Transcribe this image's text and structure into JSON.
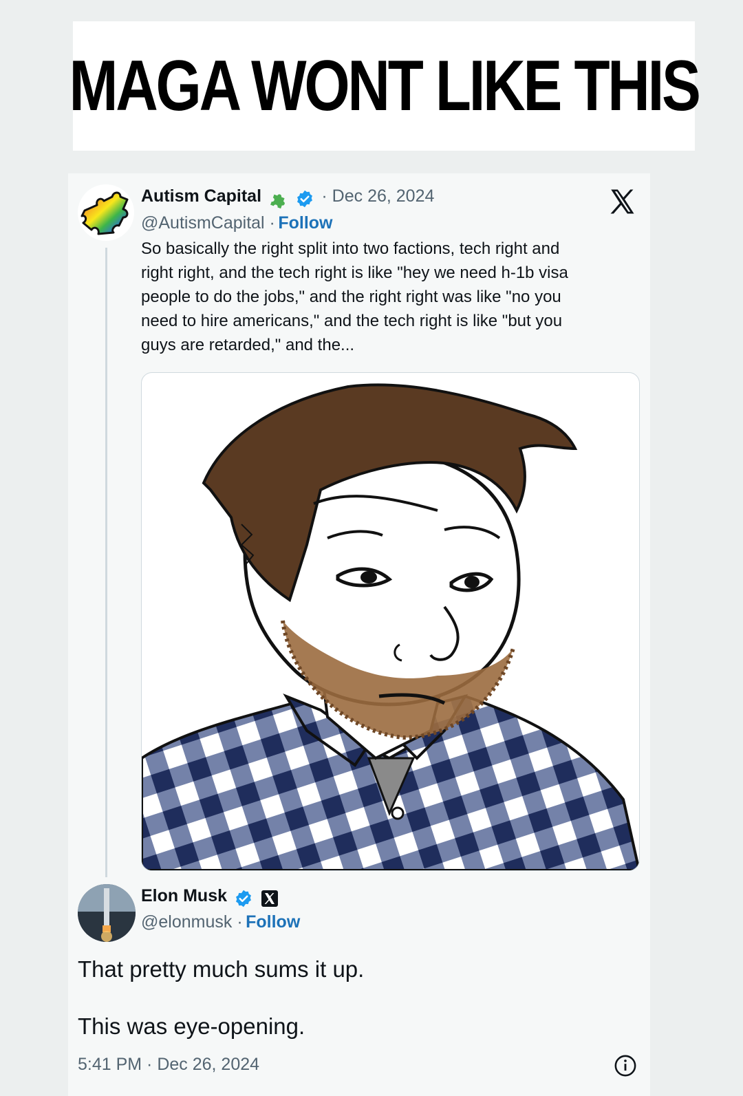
{
  "banner": {
    "text": "MAGA WONT LIKE THIS"
  },
  "tweet": {
    "author_name": "Autism Capital",
    "date": "· Dec 26, 2024",
    "handle": "@AutismCapital ·",
    "follow_label": "Follow",
    "body": "So basically the right split into two factions, tech right and\nright right, and the tech right is like \"hey we need h-1b visa\npeople to do the jobs,\" and the right right was like \"no you\nneed to hire americans,\" and the tech right is like  \"but you\nguys are retarded,\" and the..."
  },
  "reply": {
    "author_name": "Elon Musk",
    "handle": "@elonmusk ·",
    "follow_label": "Follow",
    "line1": "That pretty much sums it up.",
    "line2": "This was eye-opening.",
    "timestamp": "5:41 PM · Dec 26, 2024"
  },
  "icons": [
    "puzzle-avatar-icon",
    "puzzle-icon",
    "verified-badge-icon",
    "x-logo-icon",
    "x-affiliate-badge-icon",
    "info-icon"
  ],
  "colors": {
    "verified": "#1d9bf0",
    "follow": "#1d72b8",
    "muted": "#536471",
    "text": "#0f1419",
    "beard": "#9b6b3f",
    "hair": "#5a3a22",
    "plaid": "#1f2d5c"
  }
}
